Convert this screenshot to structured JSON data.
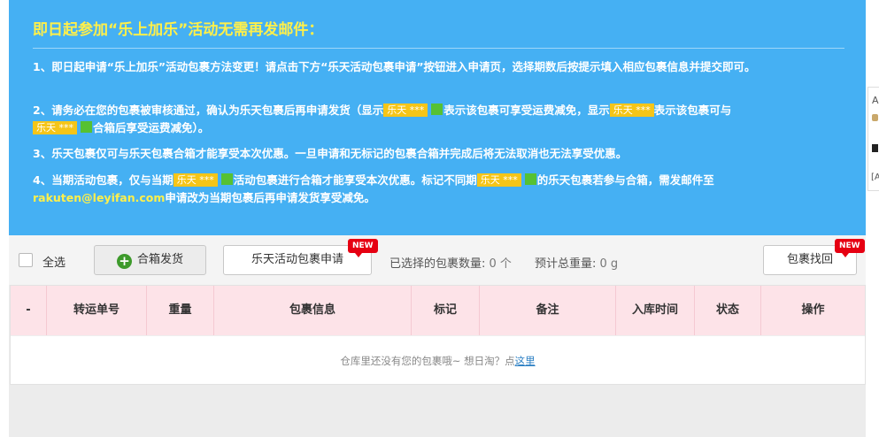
{
  "notice": {
    "title": "即日起参加“乐上加乐”活动无需再发邮件：",
    "p1": "1、即日起申请“乐上加乐”活动包裹方法变更！请点击下方“乐天活动包裹申请”按钮进入申请页，选择期数后按提示填入相应包裹信息并提交即可。",
    "p2_a": "2、请务必在您的包裹被审核通过，确认为乐天包裹后再申请发货（显示",
    "p2_b": "表示该包裹可享受运费减免，显示",
    "p2_c": "表示该包裹可与",
    "p2_d": "合箱后享受运费减免）。",
    "p3": "3、乐天包裹仅可与乐天包裹合箱才能享受本次优惠。一旦申请和无标记的包裹合箱并完成后将无法取消也无法享受优惠。",
    "p4_a": "4、当期活动包裹，仅与当期",
    "p4_b": "活动包裹进行合箱才能享受本次优惠。标记不同期",
    "p4_c": "的乐天包裹若参与合箱，需发邮件至",
    "p4_email": "rakuten@leyifan.com",
    "p4_d": "申请改为当期包裹后再申请发货享受减免。",
    "tag_text": "乐天 ***",
    "colors": {
      "background": "#45b0f3",
      "highlight": "#fff04a",
      "tag": "#f5c518",
      "green_box": "#56c133"
    }
  },
  "toolbar": {
    "select_all": "全选",
    "combine_button": "合箱发货",
    "apply_button": "乐天活动包裹申请",
    "recover_button": "包裹找回",
    "new_badge": "NEW",
    "selected_count_label": "已选择的包裹数量:",
    "selected_count_value": "0 个",
    "total_weight_label": "预计总重量:",
    "total_weight_value": "0 g"
  },
  "table": {
    "columns": [
      "-",
      "转运单号",
      "重量",
      "包裹信息",
      "标记",
      "备注",
      "入库时间",
      "状态",
      "操作"
    ],
    "empty_text": "仓库里还没有您的包裹哦~ 想日淘？点",
    "empty_link": "这里",
    "header_bg": "#fde3e8"
  },
  "side_panel": {
    "letter_a": "A",
    "letter_b": "[A"
  }
}
